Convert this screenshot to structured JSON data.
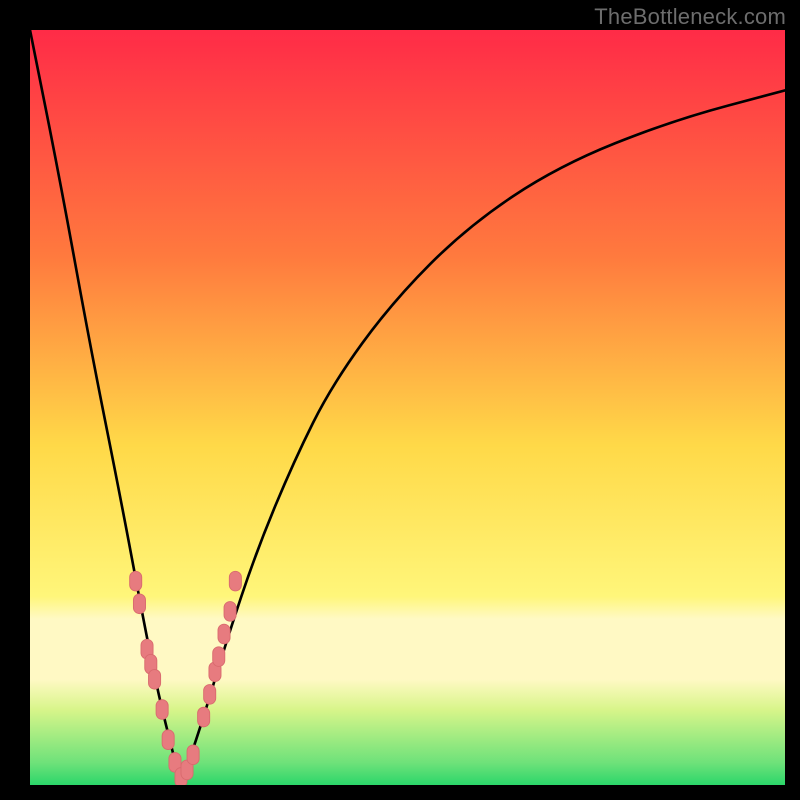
{
  "watermark": "TheBottleneck.com",
  "colors": {
    "frame": "#000000",
    "grad_top": "#ff2b47",
    "grad_mid1": "#ff8a3a",
    "grad_mid2": "#ffdf4a",
    "grad_low1": "#fff79a",
    "grad_low2": "#c7f57a",
    "grad_bottom": "#2bd66a",
    "curve": "#000000",
    "marker_fill": "#e77b7f",
    "marker_stroke": "#d96a6e"
  },
  "chart_data": {
    "type": "line",
    "title": "",
    "xlabel": "",
    "ylabel": "",
    "xlim": [
      0,
      100
    ],
    "ylim": [
      0,
      100
    ],
    "comment": "V-shaped bottleneck curve; higher y = worse (red), lower y = better (green). Minimum at x≈20 with y=0.",
    "series": [
      {
        "name": "bottleneck-curve",
        "x": [
          0,
          4,
          8,
          12,
          15,
          17,
          19,
          20,
          21,
          23,
          26,
          30,
          35,
          40,
          48,
          58,
          70,
          85,
          100
        ],
        "values": [
          100,
          80,
          58,
          38,
          22,
          12,
          4,
          0,
          3,
          9,
          19,
          31,
          43,
          53,
          64,
          74,
          82,
          88,
          92
        ]
      }
    ],
    "markers": {
      "name": "highlighted-points",
      "x": [
        14.0,
        14.5,
        15.5,
        16.0,
        16.5,
        17.5,
        18.3,
        19.2,
        20.0,
        20.8,
        21.6,
        23.0,
        23.8,
        24.5,
        25.0,
        25.7,
        26.5,
        27.2
      ],
      "y": [
        27,
        24,
        18,
        16,
        14,
        10,
        6,
        3,
        1,
        2,
        4,
        9,
        12,
        15,
        17,
        20,
        23,
        27
      ]
    },
    "gradient_stops": [
      {
        "pos": 0.0,
        "color": "#ff2b47"
      },
      {
        "pos": 0.3,
        "color": "#ff7a3e"
      },
      {
        "pos": 0.55,
        "color": "#ffd948"
      },
      {
        "pos": 0.75,
        "color": "#fff67a"
      },
      {
        "pos": 0.78,
        "color": "#fff9c4"
      },
      {
        "pos": 0.86,
        "color": "#fff9c4"
      },
      {
        "pos": 0.9,
        "color": "#d8f58a"
      },
      {
        "pos": 0.97,
        "color": "#6fe27a"
      },
      {
        "pos": 1.0,
        "color": "#2bd66a"
      }
    ]
  }
}
